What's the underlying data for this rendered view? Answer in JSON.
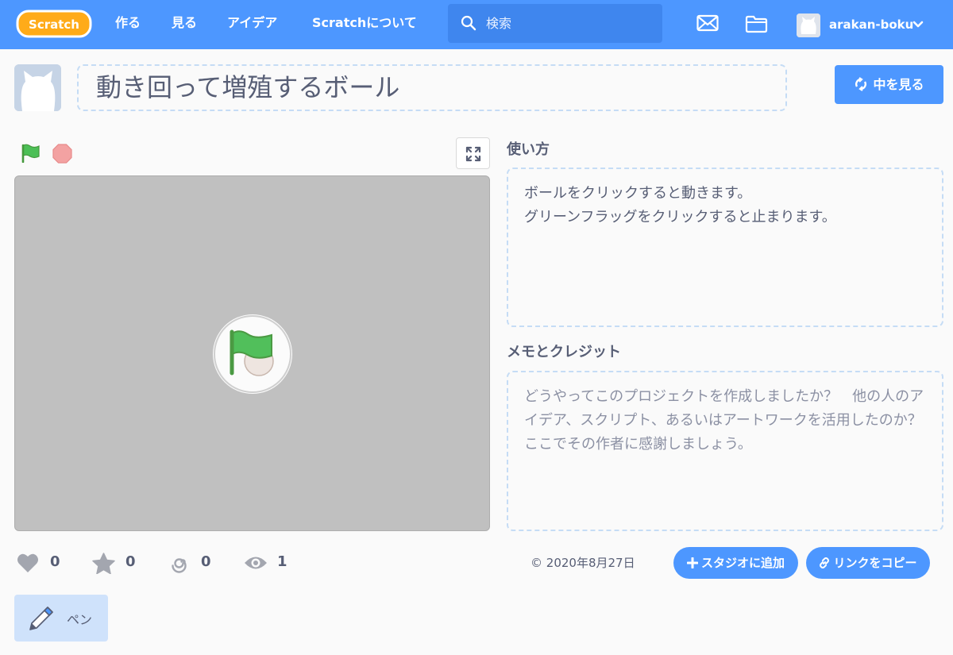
{
  "nav": {
    "logo": "Scratch",
    "links": [
      "作る",
      "見る",
      "アイデア",
      "Scratchについて"
    ],
    "search_placeholder": "検索",
    "username": "arakan-boku"
  },
  "project": {
    "title": "動き回って増殖するボール",
    "see_inside_label": "中を見る"
  },
  "instructions": {
    "label": "使い方",
    "text": "ボールをクリックすると動きます。\nグリーンフラッグをクリックすると止まります。"
  },
  "notes": {
    "label": "メモとクレジット",
    "placeholder": "どうやってこのプロジェクトを作成しましたか？　他の人のアイデア、スクリプト、あるいはアートワークを活用したのか？　ここでその作者に感謝しましょう。"
  },
  "stats": {
    "loves": "0",
    "favorites": "0",
    "remixes": "0",
    "views": "1"
  },
  "meta": {
    "date": "2020年8月27日",
    "add_to_studio": "スタジオに追加",
    "copy_link": "リンクをコピー"
  },
  "extensions": {
    "pen": "ペン"
  },
  "colors": {
    "brand_blue": "#4d97ff",
    "flag_green": "#4cbf56",
    "stop_red": "#ec5959",
    "stage_gray": "#c0c0c0"
  }
}
